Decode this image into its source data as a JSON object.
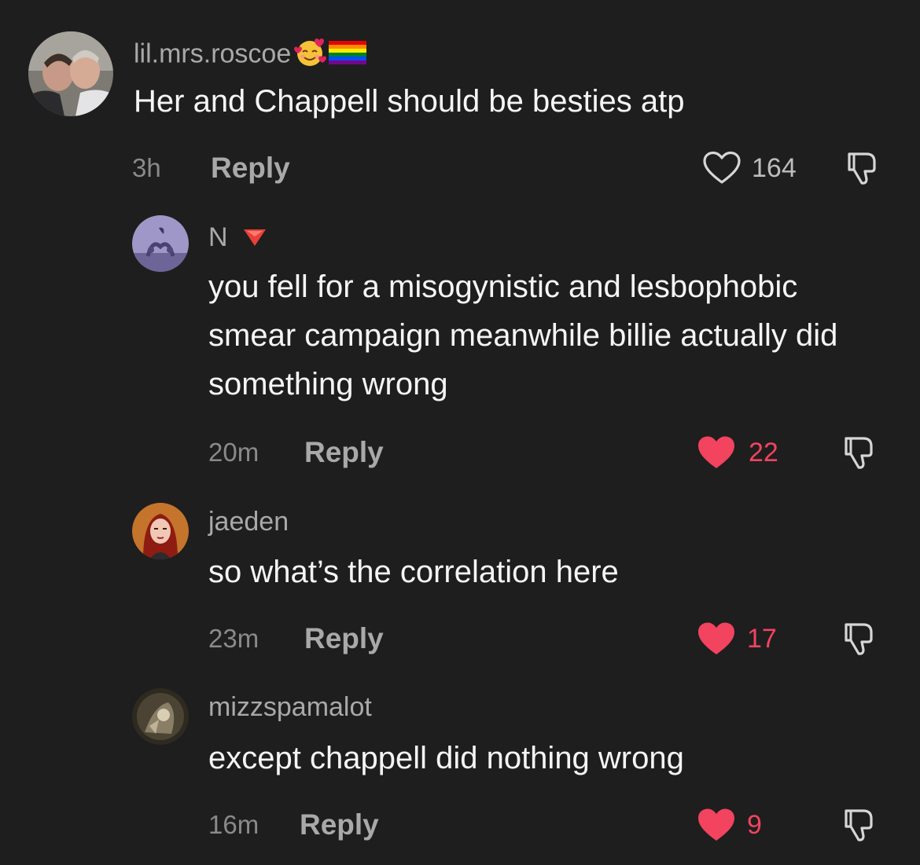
{
  "colors": {
    "background": "#1e1e1e",
    "liked": "#f2435f",
    "muted": "#a9a9a9"
  },
  "comments": [
    {
      "username": "lil.mrs.roscoe",
      "username_emojis": [
        "smiling-face-with-hearts",
        "rainbow-flag"
      ],
      "text": "Her and Chappell should be besties atp",
      "time": "3h",
      "reply_label": "Reply",
      "likes": "164",
      "liked": false
    },
    {
      "username": "N",
      "username_emojis": [
        "red-triangle-down"
      ],
      "text": "you fell for a misogynistic and lesbophobic smear campaign meanwhile billie actually did something wrong",
      "time": "20m",
      "reply_label": "Reply",
      "likes": "22",
      "liked": true
    },
    {
      "username": "jaeden",
      "text": "so what’s the correlation here",
      "time": "23m",
      "reply_label": "Reply",
      "likes": "17",
      "liked": true
    },
    {
      "username": "mizzspamalot",
      "text": "except chappell did nothing wrong",
      "time": "16m",
      "reply_label": "Reply",
      "likes": "9",
      "liked": true
    }
  ]
}
